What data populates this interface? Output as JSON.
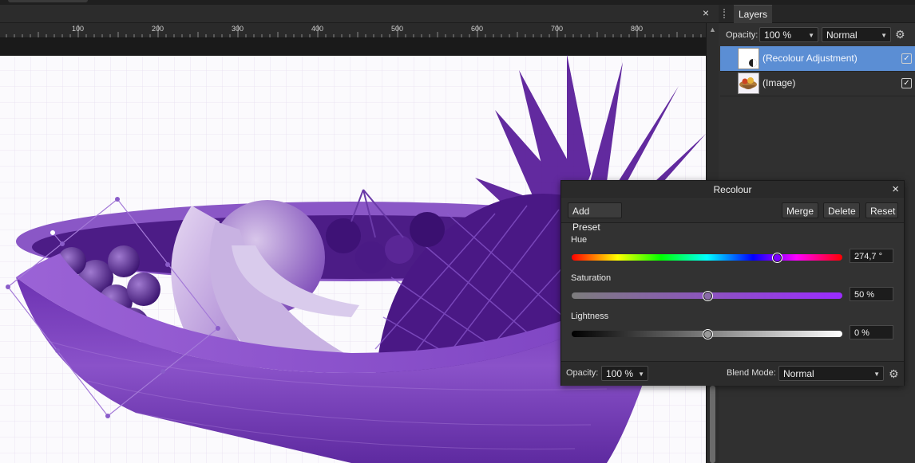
{
  "document": {
    "close_glyph": "×",
    "ruler_labels": [
      "100",
      "200",
      "300",
      "400",
      "500",
      "600",
      "700",
      "800"
    ]
  },
  "panel": {
    "tab_label": "Layers",
    "opacity_label": "Opacity:",
    "opacity_value": "100 %",
    "blend_value": "Normal",
    "layers": [
      {
        "name": "(Recolour Adjustment)",
        "selected": true,
        "visible": true
      },
      {
        "name": "(Image)",
        "selected": false,
        "visible": true
      }
    ]
  },
  "recolour": {
    "title": "Recolour",
    "close_glyph": "×",
    "buttons": {
      "add_preset": "Add Preset",
      "merge": "Merge",
      "delete": "Delete",
      "reset": "Reset"
    },
    "hue": {
      "label": "Hue",
      "value": "274,7 °",
      "fraction": 0.757
    },
    "saturation": {
      "label": "Saturation",
      "value": "50 %",
      "fraction": 0.5
    },
    "lightness": {
      "label": "Lightness",
      "value": "0 %",
      "fraction": 0.5
    },
    "footer": {
      "opacity_label": "Opacity:",
      "opacity_value": "100 %",
      "blend_label": "Blend Mode:",
      "blend_value": "Normal"
    }
  },
  "colors": {
    "accent_selected": "#5b8ed4",
    "tint": "#7b3fbf"
  },
  "icons": {
    "settings": "gear-icon",
    "dropdown": "chevron-down-icon",
    "checkbox": "checkbox-checked-icon"
  }
}
